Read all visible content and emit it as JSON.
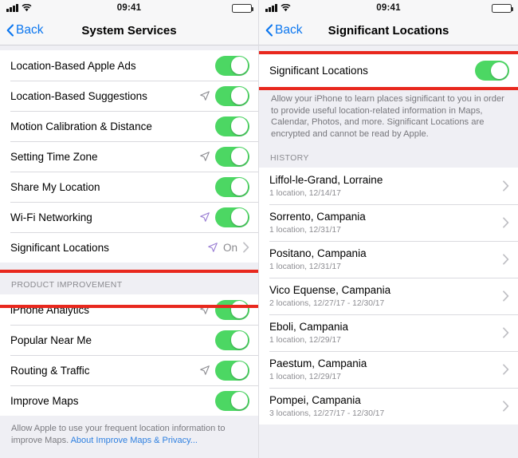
{
  "left": {
    "status_bar": {
      "time": "09:41",
      "signal_icon": "cellular-signal-icon",
      "wifi_icon": "wifi-icon",
      "battery_icon": "battery-full-icon"
    },
    "nav": {
      "back_label": "Back",
      "back_icon": "chevron-left-icon",
      "title": "System Services"
    },
    "rows_main": [
      {
        "label": "Location-Based Apple Ads",
        "arrow": "none",
        "toggle": "on"
      },
      {
        "label": "Location-Based Suggestions",
        "arrow": "gray",
        "toggle": "on"
      },
      {
        "label": "Motion Calibration & Distance",
        "arrow": "none",
        "toggle": "on"
      },
      {
        "label": "Setting Time Zone",
        "arrow": "gray",
        "toggle": "on"
      },
      {
        "label": "Share My Location",
        "arrow": "none",
        "toggle": "on"
      },
      {
        "label": "Wi-Fi Networking",
        "arrow": "purple",
        "toggle": "on"
      },
      {
        "label": "Significant Locations",
        "arrow": "purple",
        "value": "On",
        "disclosure": true
      }
    ],
    "section_title": "PRODUCT IMPROVEMENT",
    "rows_product": [
      {
        "label": "iPhone Analytics",
        "arrow": "gray",
        "toggle": "on"
      },
      {
        "label": "Popular Near Me",
        "arrow": "none",
        "toggle": "on"
      },
      {
        "label": "Routing & Traffic",
        "arrow": "gray",
        "toggle": "on"
      },
      {
        "label": "Improve Maps",
        "arrow": "none",
        "toggle": "on"
      }
    ],
    "footer": {
      "text": "Allow Apple to use your frequent location information to improve Maps. ",
      "link": "About Improve Maps & Privacy..."
    }
  },
  "right": {
    "status_bar": {
      "time": "09:41",
      "signal_icon": "cellular-signal-icon",
      "wifi_icon": "wifi-icon",
      "battery_icon": "battery-full-icon"
    },
    "nav": {
      "back_label": "Back",
      "back_icon": "chevron-left-icon",
      "title": "Significant Locations"
    },
    "toggle_row": {
      "label": "Significant Locations",
      "toggle": "on"
    },
    "description": "Allow your iPhone to learn places significant to you in order to provide useful location-related information in Maps, Calendar, Photos, and more. Significant Locations are encrypted and cannot be read by Apple.",
    "history_title": "HISTORY",
    "history": [
      {
        "title": "Liffol-le-Grand, Lorraine",
        "subtitle": "1 location, 12/14/17"
      },
      {
        "title": "Sorrento, Campania",
        "subtitle": "1 location, 12/31/17"
      },
      {
        "title": "Positano, Campania",
        "subtitle": "1 location, 12/31/17"
      },
      {
        "title": "Vico Equense, Campania",
        "subtitle": "2 locations, 12/27/17 - 12/30/17"
      },
      {
        "title": "Eboli, Campania",
        "subtitle": "1 location, 12/29/17"
      },
      {
        "title": "Paestum, Campania",
        "subtitle": "1 location, 12/29/17"
      },
      {
        "title": "Pompei, Campania",
        "subtitle": "3 locations, 12/27/17 - 12/30/17"
      }
    ]
  },
  "colors": {
    "toggle_on": "#4cd763",
    "highlight": "#e8281e",
    "link": "#2d7fe0",
    "tint": "#0b76ef",
    "arrow_purple": "#9b7fd4",
    "arrow_gray": "#8e8e93"
  }
}
